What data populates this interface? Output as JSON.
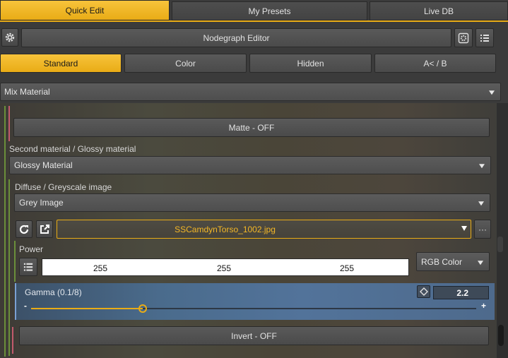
{
  "tabs": [
    "Quick Edit",
    "My Presets",
    "Live DB"
  ],
  "toolbar": {
    "nodegraph_label": "Nodegraph Editor"
  },
  "filter_tabs": [
    "Standard",
    "Color",
    "Hidden",
    "A< / B"
  ],
  "material_select": "Mix Material",
  "matte_button": "Matte - OFF",
  "second_material": {
    "label": "Second material / Glossy material",
    "value": "Glossy Material"
  },
  "diffuse": {
    "label": "Diffuse / Greyscale image",
    "value": "Grey Image"
  },
  "image_file": "SSCamdynTorso_1002.jpg",
  "more_label": "···",
  "power": {
    "label": "Power",
    "r": "255",
    "g": "255",
    "b": "255",
    "mode": "RGB Color"
  },
  "gamma": {
    "label": "Gamma (0.1/8)",
    "value": "2.2",
    "minus": "-",
    "plus": "+",
    "slider_fraction": 0.25
  },
  "invert_button": "Invert - OFF",
  "colors": {
    "accent": "#f3b826",
    "highlight_text": "#f4b726"
  }
}
